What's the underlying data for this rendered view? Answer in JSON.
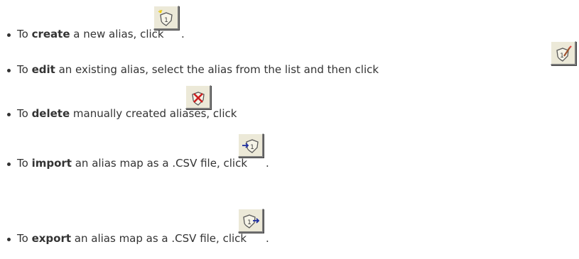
{
  "items": [
    {
      "prefix": "To ",
      "keyword": "create",
      "suffix": " a new alias, click ",
      "end": ".",
      "icon": "new-alias-icon"
    },
    {
      "prefix": "To ",
      "keyword": "edit",
      "suffix": " an existing alias, select the alias from the list and then click ",
      "end": "",
      "icon": "edit-alias-icon"
    },
    {
      "prefix": "To ",
      "keyword": "delete",
      "suffix": " manually created aliases, click ",
      "end": ".",
      "icon": "delete-alias-icon"
    },
    {
      "prefix": "To ",
      "keyword": "import",
      "suffix": " an alias map as a .CSV file, click ",
      "end": ".",
      "icon": "import-alias-icon"
    },
    {
      "prefix": "To ",
      "keyword": "export",
      "suffix": " an alias map as a .CSV file, click ",
      "end": ".",
      "icon": "export-alias-icon"
    }
  ]
}
